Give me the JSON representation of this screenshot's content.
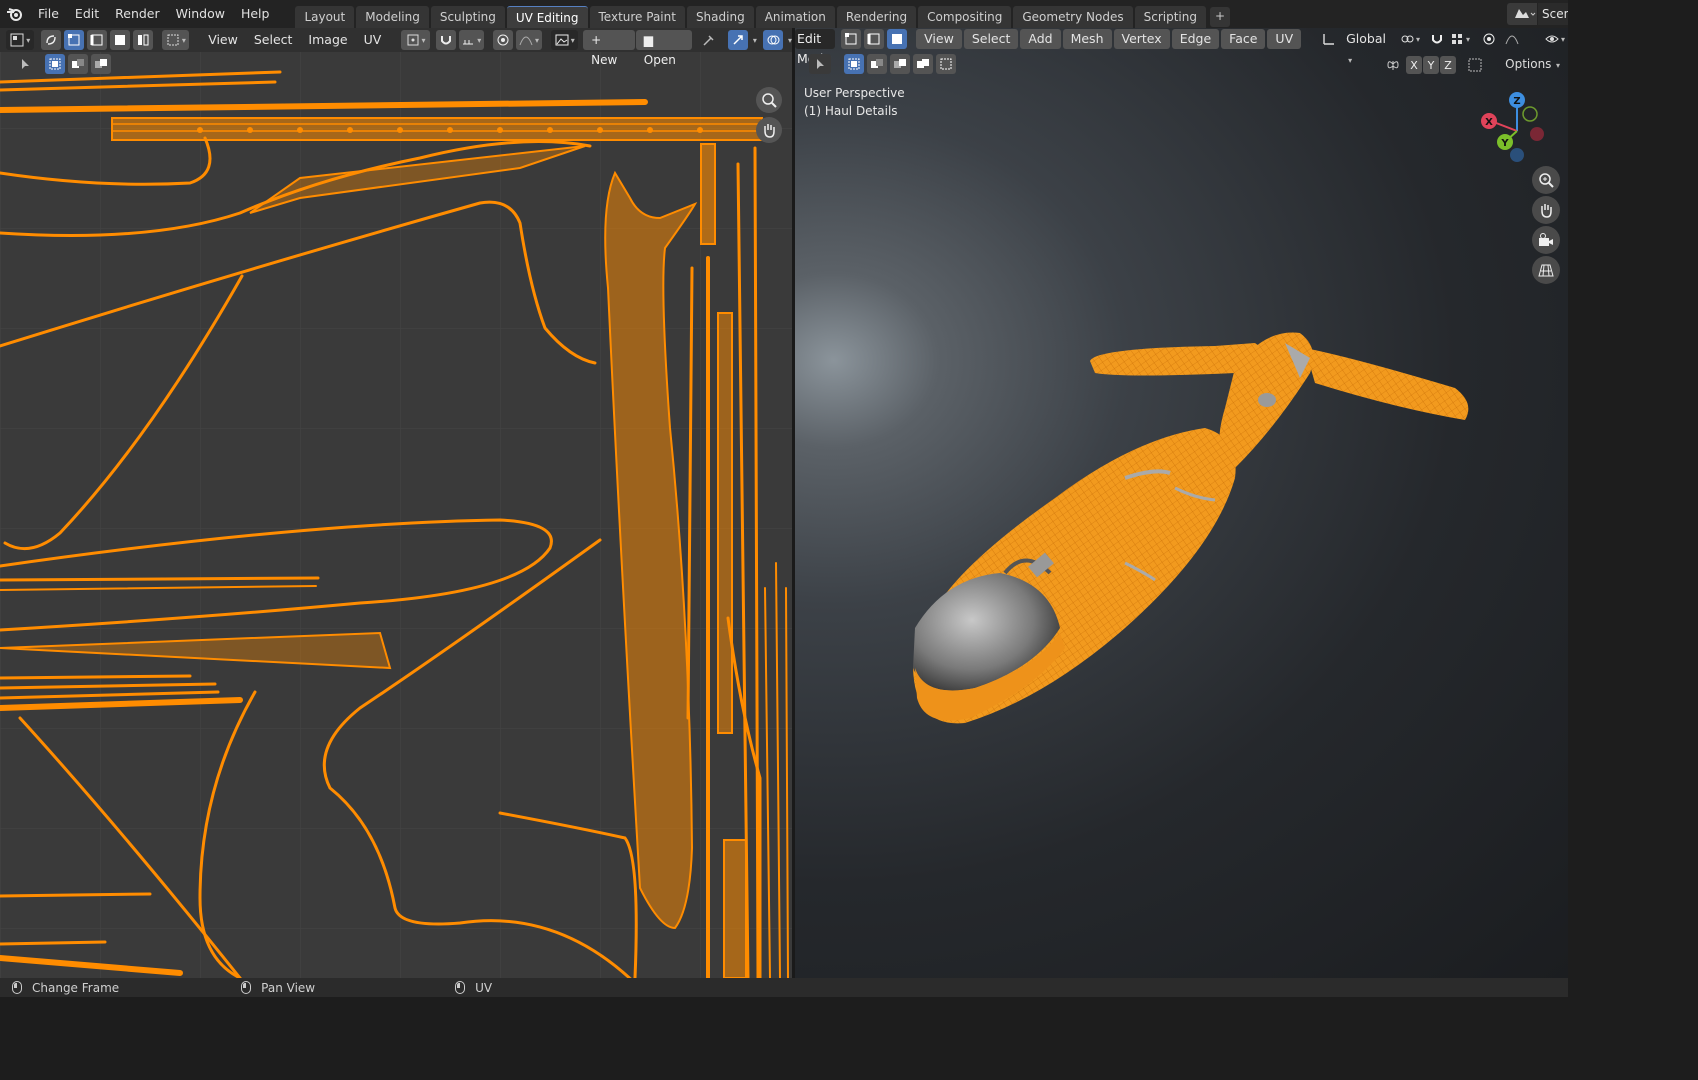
{
  "app": {
    "name": "Blender"
  },
  "menubar": {
    "items": [
      "File",
      "Edit",
      "Render",
      "Window",
      "Help"
    ]
  },
  "workspaces": {
    "tabs": [
      "Layout",
      "Modeling",
      "Sculpting",
      "UV Editing",
      "Texture Paint",
      "Shading",
      "Animation",
      "Rendering",
      "Compositing",
      "Geometry Nodes",
      "Scripting"
    ],
    "active": "UV Editing",
    "add_label": "+"
  },
  "scene": {
    "label": "Scen"
  },
  "uv_editor": {
    "menus": [
      "View",
      "Select",
      "Image",
      "UV"
    ],
    "new_label": "New",
    "open_label": "Open"
  },
  "viewport": {
    "mode": "Edit Mode",
    "menus": [
      "View",
      "Select",
      "Add",
      "Mesh",
      "Vertex",
      "Edge",
      "Face",
      "UV"
    ],
    "orientation": "Global",
    "options_label": "Options",
    "axis_lock": [
      "X",
      "Y",
      "Z"
    ],
    "perspective": "User Perspective",
    "object_info": "(1) Haul Details",
    "gizmo_axes": {
      "x": "X",
      "y": "Y",
      "z": "Z"
    },
    "colors": {
      "x": "#e0435a",
      "y": "#7bbf2a",
      "z": "#3d8ee0"
    }
  },
  "statusbar": {
    "items": [
      "Change Frame",
      "Pan View",
      "UV"
    ]
  },
  "colors": {
    "selection_orange": "#ff8c00",
    "active_blue": "#4772b3"
  }
}
